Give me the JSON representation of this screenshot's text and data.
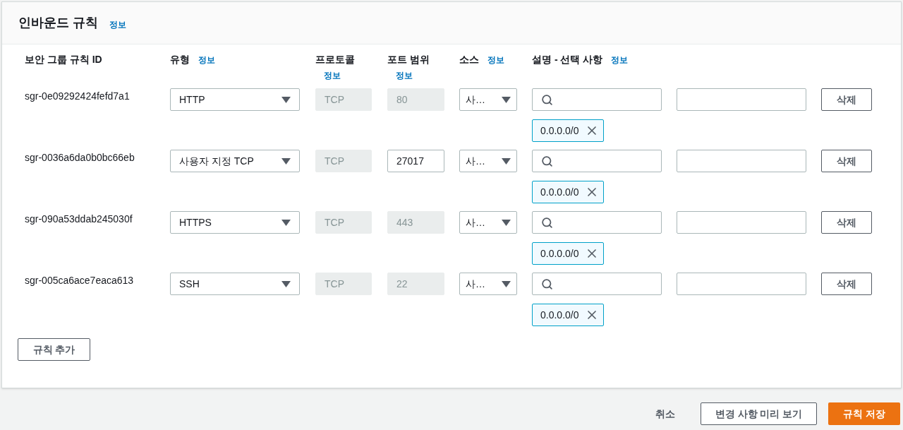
{
  "panel": {
    "title": "인바운드 규칙",
    "info_link": "정보"
  },
  "columns": [
    {
      "label": "보안 그룹 규칙 ID"
    },
    {
      "label": "유형",
      "info": "정보"
    },
    {
      "label": "프로토콜",
      "info": "정보"
    },
    {
      "label": "포트 범위",
      "info": "정보"
    },
    {
      "label": "소스",
      "info": "정보"
    },
    {
      "label": "설명 - 선택 사항",
      "info": "정보"
    }
  ],
  "rules": [
    {
      "id": "sgr-0e09292424fefd7a1",
      "type": "HTTP",
      "protocol": "TCP",
      "port": "80",
      "port_disabled": true,
      "source": "사…",
      "cidr": "0.0.0.0/0",
      "delete": "삭제"
    },
    {
      "id": "sgr-0036a6da0b0bc66eb",
      "type": "사용자 지정 TCP",
      "protocol": "TCP",
      "port": "27017",
      "port_disabled": false,
      "source": "사…",
      "cidr": "0.0.0.0/0",
      "delete": "삭제"
    },
    {
      "id": "sgr-090a53ddab245030f",
      "type": "HTTPS",
      "protocol": "TCP",
      "port": "443",
      "port_disabled": true,
      "source": "사…",
      "cidr": "0.0.0.0/0",
      "delete": "삭제"
    },
    {
      "id": "sgr-005ca6ace7eaca613",
      "type": "SSH",
      "protocol": "TCP",
      "port": "22",
      "port_disabled": true,
      "source": "사…",
      "cidr": "0.0.0.0/0",
      "delete": "삭제"
    }
  ],
  "add_rule_button": "규칙 추가",
  "footer": {
    "cancel": "취소",
    "preview": "변경 사항 미리 보기",
    "save": "규칙 저장"
  }
}
